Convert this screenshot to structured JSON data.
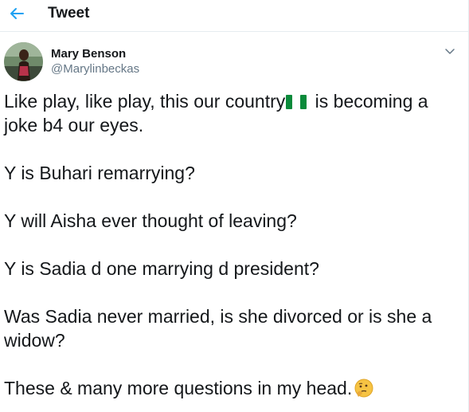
{
  "header": {
    "title": "Tweet",
    "back_icon": "arrow-left-icon",
    "accent_color": "#1da1f2"
  },
  "author": {
    "name": "Mary Benson",
    "handle": "@Marylinbeckas",
    "avatar_icon": "avatar-photo",
    "more_icon": "chevron-down-icon"
  },
  "tweet": {
    "line1_a": "Like play, like play, this our country",
    "line1_b": " is becoming a",
    "line2": "joke b4 our eyes.",
    "line3": "Y is Buhari remarrying?",
    "line4": "Y will Aisha ever thought of leaving?",
    "line5": "Y is Sadia d one marrying d president?",
    "line6a": "Was Sadia never married, is she divorced or is she a",
    "line6b": "widow?",
    "line7": "These & many more questions in my head.",
    "flag_icon": "nigeria-flag-icon",
    "emoji_icon": "thinking-face-icon"
  }
}
